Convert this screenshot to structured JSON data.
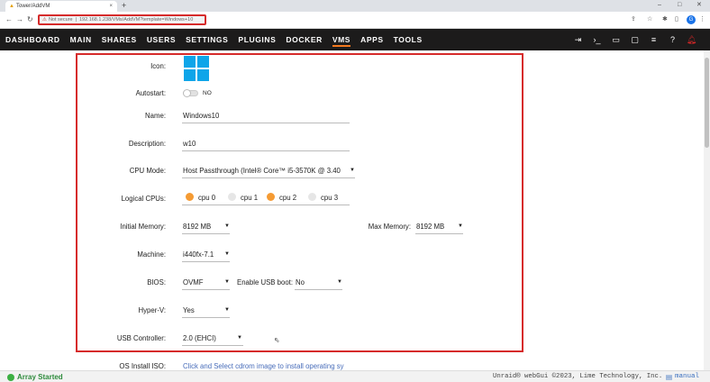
{
  "browser": {
    "tab_title": "Tower/AddVM",
    "close_glyph": "×",
    "new_tab_glyph": "+",
    "url_warning": "Not secure",
    "url_sep": "|",
    "url": "192.168.1.238/VMs/AddVM?template=Windows+10",
    "profile_initial": "G",
    "minimize_glyph": "–",
    "maximize_glyph": "□",
    "window_close_glyph": "✕"
  },
  "nav": {
    "items": [
      "DASHBOARD",
      "MAIN",
      "SHARES",
      "USERS",
      "SETTINGS",
      "PLUGINS",
      "DOCKER",
      "VMS",
      "APPS",
      "TOOLS"
    ],
    "active": "VMS"
  },
  "form": {
    "icon_label": "Icon:",
    "autostart_label": "Autostart:",
    "autostart_value": "NO",
    "name_label": "Name:",
    "name_value": "Windows10",
    "description_label": "Description:",
    "description_value": "w10",
    "cpu_mode_label": "CPU Mode:",
    "cpu_mode_value": "Host Passthrough (Intel® Core™ i5-3570K @ 3.40",
    "logical_cpus_label": "Logical CPUs:",
    "cpus": [
      {
        "label": "cpu 0",
        "selected": true
      },
      {
        "label": "cpu 1",
        "selected": false
      },
      {
        "label": "cpu 2",
        "selected": true
      },
      {
        "label": "cpu 3",
        "selected": false
      }
    ],
    "initial_memory_label": "Initial Memory:",
    "initial_memory_value": "8192 MB",
    "max_memory_label": "Max Memory:",
    "max_memory_value": "8192 MB",
    "machine_label": "Machine:",
    "machine_value": "i440fx-7.1",
    "bios_label": "BIOS:",
    "bios_value": "OVMF",
    "usb_boot_label": "Enable USB boot:",
    "usb_boot_value": "No",
    "hyperv_label": "Hyper-V:",
    "hyperv_value": "Yes",
    "usb_controller_label": "USB Controller:",
    "usb_controller_value": "2.0 (EHCI)",
    "os_iso_label": "OS Install ISO:",
    "os_iso_placeholder": "Click and Select cdrom image to install operating sy"
  },
  "footer": {
    "status": "Array Started",
    "copyright": "Unraid® webGui ©2023, Lime Technology, Inc.",
    "manual_label": "manual"
  },
  "colors": {
    "accent": "#f47a1f",
    "highlight_box": "#d62b2b",
    "windows_blue": "#0ea5e9",
    "status_green": "#3cb043"
  }
}
